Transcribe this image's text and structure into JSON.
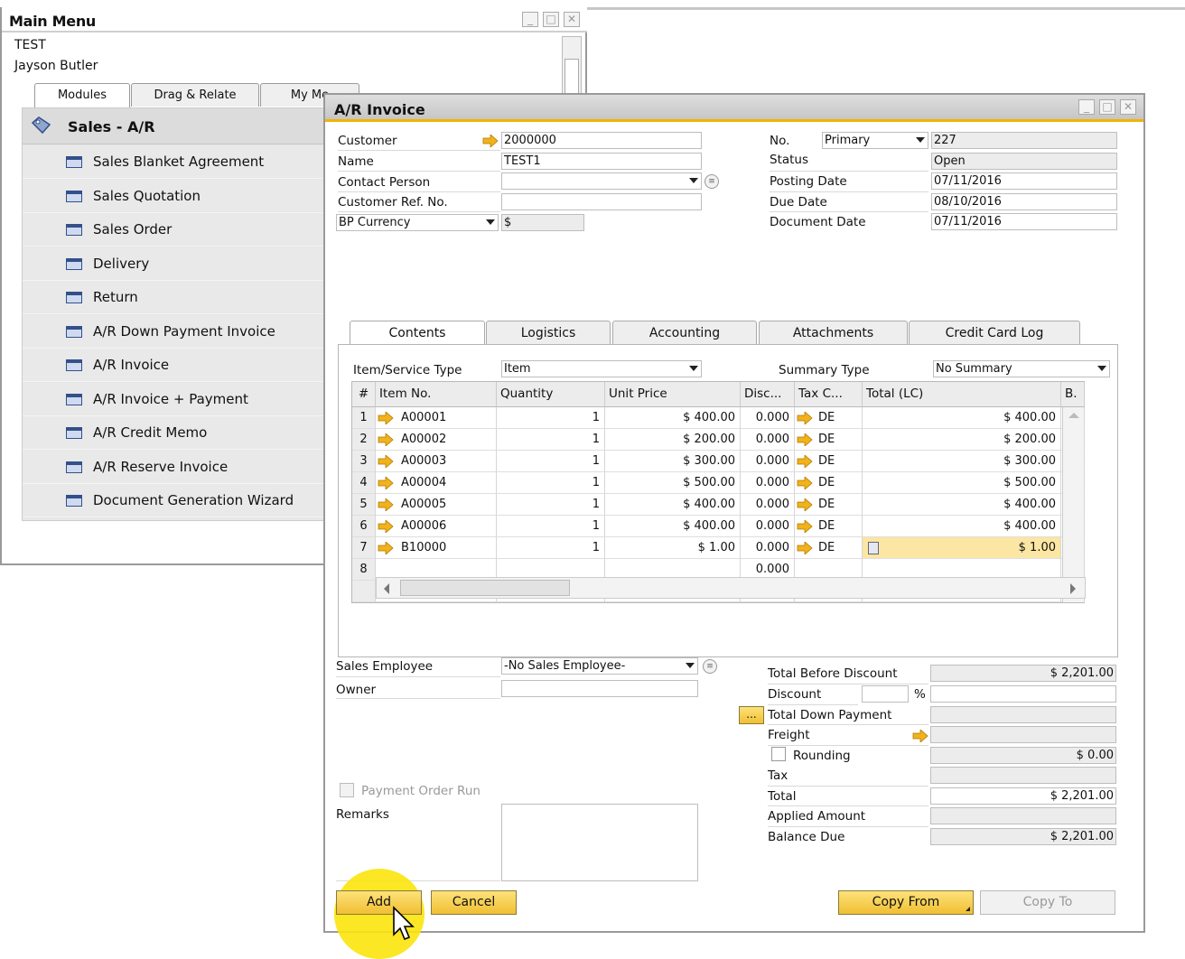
{
  "main_menu": {
    "title": "Main Menu",
    "company": "TEST",
    "user": "Jayson Butler",
    "tabs": [
      "Modules",
      "Drag & Relate",
      "My Me"
    ],
    "module_title": "Sales - A/R",
    "items": [
      "Sales Blanket Agreement",
      "Sales Quotation",
      "Sales Order",
      "Delivery",
      "Return",
      "A/R Down Payment Invoice",
      "A/R Invoice",
      "A/R Invoice + Payment",
      "A/R Credit Memo",
      "A/R Reserve Invoice",
      "Document Generation Wizard"
    ]
  },
  "ar": {
    "title": "A/R Invoice",
    "header_left": {
      "customer_label": "Customer",
      "customer": "2000000",
      "name_label": "Name",
      "name": "TEST1",
      "contact_label": "Contact Person",
      "contact": "",
      "ref_label": "Customer Ref. No.",
      "ref": "",
      "currency_label": "BP Currency",
      "currency": "$"
    },
    "header_right": {
      "no_label": "No.",
      "series": "Primary",
      "no": "227",
      "status_label": "Status",
      "status": "Open",
      "posting_label": "Posting Date",
      "posting": "07/11/2016",
      "due_label": "Due Date",
      "due": "08/10/2016",
      "docdate_label": "Document Date",
      "docdate": "07/11/2016"
    },
    "tabs": [
      "Contents",
      "Logistics",
      "Accounting",
      "Attachments",
      "Credit Card Log"
    ],
    "contents": {
      "item_type_label": "Item/Service Type",
      "item_type": "Item",
      "summary_label": "Summary Type",
      "summary": "No Summary",
      "columns": [
        "#",
        "Item No.",
        "Quantity",
        "Unit Price",
        "Disc...",
        "Tax C...",
        "Total (LC)",
        "B."
      ],
      "rows": [
        {
          "n": "1",
          "item": "A00001",
          "qty": "1",
          "price": "$ 400.00",
          "disc": "0.000",
          "tax": "DE",
          "total": "$ 400.00"
        },
        {
          "n": "2",
          "item": "A00002",
          "qty": "1",
          "price": "$ 200.00",
          "disc": "0.000",
          "tax": "DE",
          "total": "$ 200.00"
        },
        {
          "n": "3",
          "item": "A00003",
          "qty": "1",
          "price": "$ 300.00",
          "disc": "0.000",
          "tax": "DE",
          "total": "$ 300.00"
        },
        {
          "n": "4",
          "item": "A00004",
          "qty": "1",
          "price": "$ 500.00",
          "disc": "0.000",
          "tax": "DE",
          "total": "$ 500.00"
        },
        {
          "n": "5",
          "item": "A00005",
          "qty": "1",
          "price": "$ 400.00",
          "disc": "0.000",
          "tax": "DE",
          "total": "$ 400.00"
        },
        {
          "n": "6",
          "item": "A00006",
          "qty": "1",
          "price": "$ 400.00",
          "disc": "0.000",
          "tax": "DE",
          "total": "$ 400.00"
        },
        {
          "n": "7",
          "item": "B10000",
          "qty": "1",
          "price": "$ 1.00",
          "disc": "0.000",
          "tax": "DE",
          "total": "$ 1.00"
        },
        {
          "n": "8",
          "item": "",
          "qty": "",
          "price": "",
          "disc": "0.000",
          "tax": "",
          "total": ""
        }
      ]
    },
    "footer_left": {
      "employee_label": "Sales Employee",
      "employee": "-No Sales Employee-",
      "owner_label": "Owner",
      "owner": "",
      "payment_run_label": "Payment Order Run",
      "remarks_label": "Remarks",
      "remarks": ""
    },
    "totals": {
      "before_discount_label": "Total Before Discount",
      "before_discount": "$ 2,201.00",
      "discount_label": "Discount",
      "discount_pct": "",
      "pct_symbol": "%",
      "discount": "",
      "down_payment_label": "Total Down Payment",
      "down_payment": "",
      "more_button": "...",
      "freight_label": "Freight",
      "freight": "",
      "rounding_label": "Rounding",
      "rounding": "$ 0.00",
      "tax_label": "Tax",
      "tax": "",
      "total_label": "Total",
      "total": "$ 2,201.00",
      "applied_label": "Applied Amount",
      "applied": "",
      "balance_label": "Balance Due",
      "balance": "$ 2,201.00"
    },
    "buttons": {
      "add": "Add",
      "cancel": "Cancel",
      "copy_from": "Copy From",
      "copy_to": "Copy To"
    }
  },
  "colors": {
    "accent": "#f0b400",
    "link_arrow": "#f2b21b",
    "button": "#f6cf52"
  }
}
